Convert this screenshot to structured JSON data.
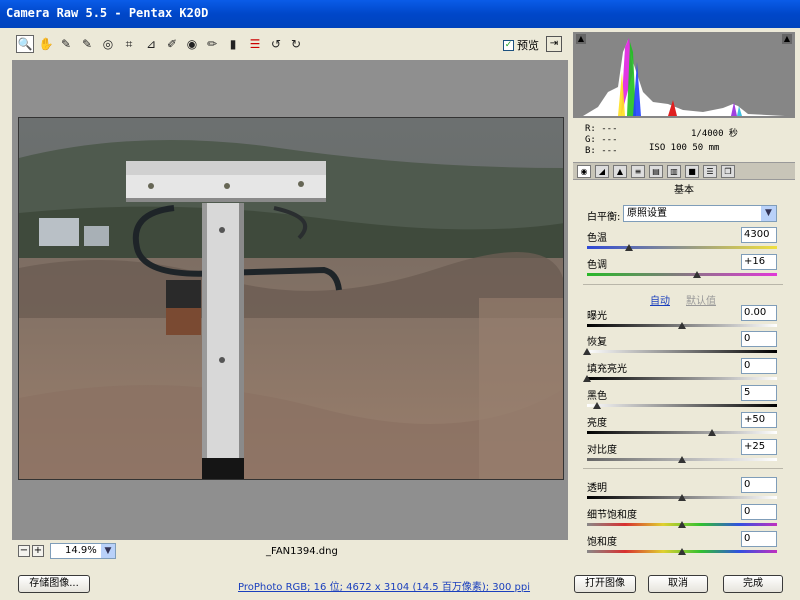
{
  "window": {
    "title": "Camera Raw 5.5 -  Pentax K20D"
  },
  "toolbar": {
    "tools": [
      {
        "name": "zoom-icon",
        "glyph": "🔍",
        "active": true
      },
      {
        "name": "hand-icon",
        "glyph": "✋",
        "active": false
      },
      {
        "name": "eyedropper-icon",
        "glyph": "✎",
        "active": false
      },
      {
        "name": "color-sampler-icon",
        "glyph": "✎",
        "active": false
      },
      {
        "name": "target-adjust-icon",
        "glyph": "◎",
        "active": false
      },
      {
        "name": "crop-icon",
        "glyph": "⌗",
        "active": false
      },
      {
        "name": "straighten-icon",
        "glyph": "⊿",
        "active": false
      },
      {
        "name": "spot-removal-icon",
        "glyph": "✐",
        "active": false
      },
      {
        "name": "red-eye-icon",
        "glyph": "◉",
        "active": false
      },
      {
        "name": "adjustment-brush-icon",
        "glyph": "✏",
        "active": false
      },
      {
        "name": "graduated-filter-icon",
        "glyph": "▮",
        "active": false
      },
      {
        "name": "preferences-icon",
        "glyph": "☰",
        "active": false,
        "red": true
      },
      {
        "name": "rotate-left-icon",
        "glyph": "↺",
        "active": false
      },
      {
        "name": "rotate-right-icon",
        "glyph": "↻",
        "active": false
      }
    ],
    "preview_label": "预览",
    "preview_checked": true
  },
  "viewer": {
    "zoom": "14.9%",
    "filename": "_FAN1394.dng"
  },
  "info": {
    "r": "R:  ---",
    "g": "G:  ---",
    "b": "B:  ---",
    "exposure": "1/4000 秒",
    "iso_lens": "ISO 100   50 mm"
  },
  "panel": {
    "title": "基本",
    "white_balance_label": "白平衡:",
    "white_balance_value": "原照设置",
    "auto_label": "自动",
    "default_label": "默认值",
    "sliders": [
      {
        "id": "temp",
        "label": "色温",
        "value": "4300",
        "pos": 0.22
      },
      {
        "id": "tint",
        "label": "色调",
        "value": "+16",
        "pos": 0.58
      },
      {
        "id": "exposure",
        "label": "曝光",
        "value": "0.00",
        "pos": 0.5
      },
      {
        "id": "recovery",
        "label": "恢复",
        "value": "0",
        "pos": 0.0
      },
      {
        "id": "fill",
        "label": "填充亮光",
        "value": "0",
        "pos": 0.0
      },
      {
        "id": "blacks",
        "label": "黑色",
        "value": "5",
        "pos": 0.05
      },
      {
        "id": "brightness",
        "label": "亮度",
        "value": "+50",
        "pos": 0.66
      },
      {
        "id": "contrast",
        "label": "对比度",
        "value": "+25",
        "pos": 0.5
      },
      {
        "id": "clarity",
        "label": "透明",
        "value": "0",
        "pos": 0.5
      },
      {
        "id": "vibrance",
        "label": "细节饱和度",
        "value": "0",
        "pos": 0.5
      },
      {
        "id": "saturation",
        "label": "饱和度",
        "value": "0",
        "pos": 0.5
      }
    ]
  },
  "footer": {
    "save_label": "存储图像...",
    "workflow_info": "ProPhoto RGB; 16 位; 4672 x 3104 (14.5 百万像素); 300 ppi",
    "open_label": "打开图像",
    "cancel_label": "取消",
    "done_label": "完成"
  },
  "colors": {
    "titlebar": "#0054e3",
    "link": "#1a3fbd"
  }
}
